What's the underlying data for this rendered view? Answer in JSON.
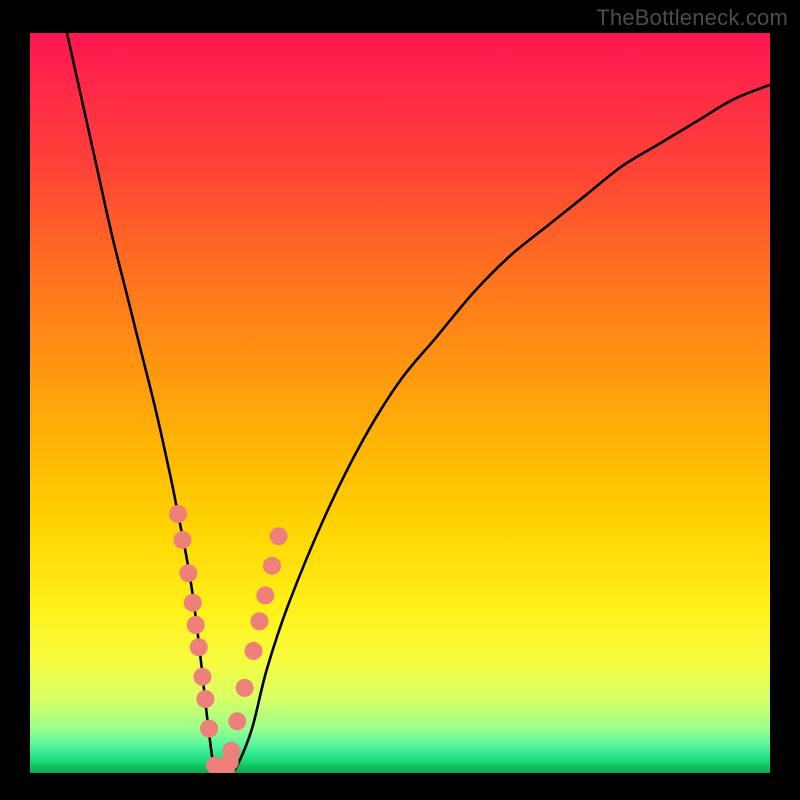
{
  "watermark": "TheBottleneck.com",
  "chart_data": {
    "type": "line",
    "title": "",
    "xlabel": "",
    "ylabel": "",
    "xlim": [
      0,
      100
    ],
    "ylim": [
      0,
      100
    ],
    "grid": false,
    "legend": false,
    "background_gradient": {
      "top": "#ff1650",
      "middle": "#ffd200",
      "bottom": "#0aa84e"
    },
    "series": [
      {
        "name": "curve",
        "color": "#000000",
        "x": [
          5,
          7,
          9,
          11,
          13,
          15,
          17,
          19,
          20,
          21,
          22,
          23,
          24,
          25,
          26,
          27,
          28,
          30,
          32,
          35,
          40,
          45,
          50,
          55,
          60,
          65,
          70,
          75,
          80,
          85,
          90,
          95,
          100
        ],
        "y": [
          100,
          91,
          82,
          73,
          65,
          57,
          49,
          40,
          35,
          30,
          24,
          16,
          7,
          0,
          0,
          0,
          1,
          6,
          14,
          23,
          35,
          45,
          53,
          59,
          65,
          70,
          74,
          78,
          82,
          85,
          88,
          91,
          93
        ]
      },
      {
        "name": "highlight-dots",
        "type": "scatter",
        "color": "#ed8079",
        "marker_size_px": 9,
        "x": [
          20.0,
          20.6,
          21.4,
          22.0,
          22.4,
          22.8,
          23.3,
          23.7,
          24.2,
          25.0,
          25.8,
          26.5,
          27.0,
          27.2,
          28.0,
          29.0,
          30.2,
          31.0,
          31.8,
          32.7,
          33.6
        ],
        "y": [
          35.0,
          31.5,
          27.0,
          23.0,
          20.0,
          17.0,
          13.0,
          10.0,
          6.0,
          1.0,
          0.5,
          0.5,
          1.5,
          3.0,
          7.0,
          11.5,
          16.5,
          20.5,
          24.0,
          28.0,
          32.0
        ]
      }
    ]
  }
}
